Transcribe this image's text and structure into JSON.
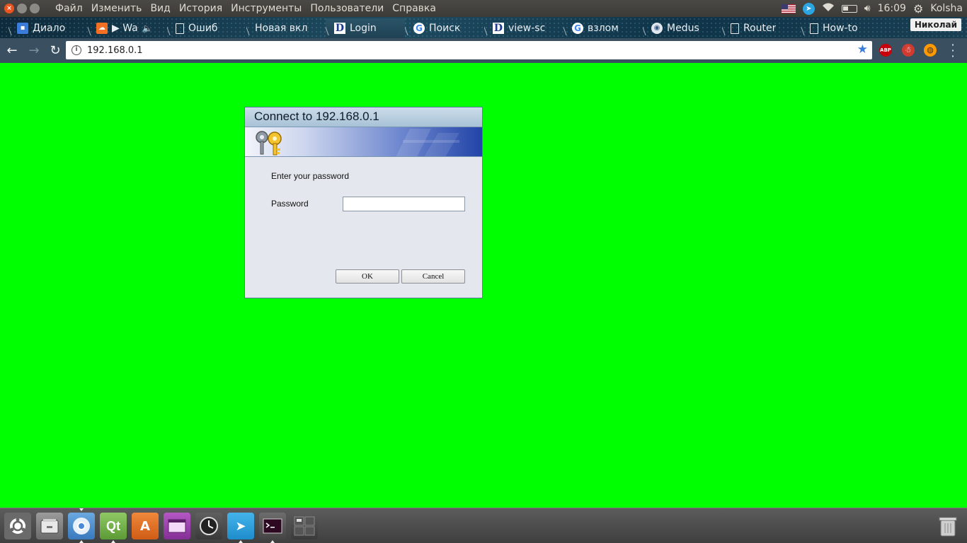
{
  "top_panel": {
    "menu": [
      "Файл",
      "Изменить",
      "Вид",
      "История",
      "Инструменты",
      "Пользователи",
      "Справка"
    ],
    "time": "16:09",
    "user": "Kolsha"
  },
  "browser": {
    "profile_name": "Николай",
    "tabs": [
      {
        "label": "Диало",
        "icon": "chat-icon"
      },
      {
        "label": "▶ Wa",
        "icon": "soundcloud-icon",
        "audio": "🔈"
      },
      {
        "label": "Ошиб",
        "icon": "document-icon"
      },
      {
        "label": "Новая вкл",
        "icon": "none"
      },
      {
        "label": "Login",
        "icon": "dlink-icon",
        "active": true
      },
      {
        "label": "Поиск",
        "icon": "google-icon"
      },
      {
        "label": "view-sc",
        "icon": "dlink-icon"
      },
      {
        "label": "взлом",
        "icon": "google-icon"
      },
      {
        "label": "Medus",
        "icon": "eye-icon"
      },
      {
        "label": "Router",
        "icon": "document-icon"
      },
      {
        "label": "How-to",
        "icon": "document-icon"
      }
    ],
    "url": "192.168.0.1",
    "extensions": {
      "abp": "ABP"
    }
  },
  "dialog": {
    "title": "Connect to 192.168.0.1",
    "prompt": "Enter your password",
    "password_label": "Password",
    "password_value": "",
    "ok_label": "OK",
    "cancel_label": "Cancel"
  },
  "dock": {
    "items": [
      "ubuntu-logo-icon",
      "files-icon",
      "chromium-icon",
      "qt-creator-icon",
      "software-center-icon",
      "window-manager-icon",
      "clock-icon",
      "telegram-icon",
      "terminal-icon",
      "workspace-switcher-icon"
    ],
    "trash": "trash-icon"
  },
  "colors": {
    "page_background": "#00ff00",
    "panel": "#3c3b37",
    "toolbar": "#3a5061",
    "dialog_background": "#e4e8ee"
  }
}
